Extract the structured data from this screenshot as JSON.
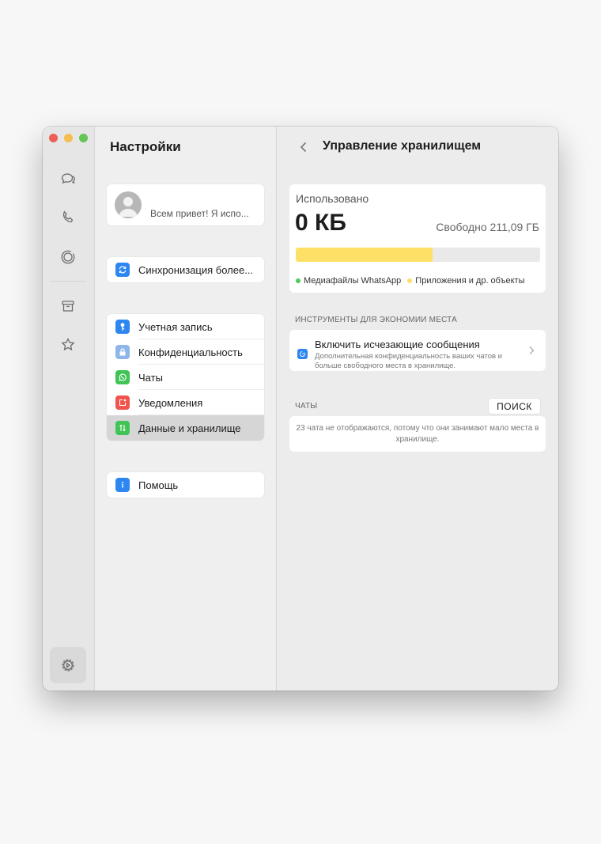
{
  "window": {
    "traffic_lights": {
      "close": "#ec5f57",
      "minimize": "#f4bf4f",
      "zoom": "#62c554"
    }
  },
  "rail": {
    "items": [
      {
        "name": "chats",
        "icon": "chat-bubbles-icon"
      },
      {
        "name": "calls",
        "icon": "phone-icon"
      },
      {
        "name": "status",
        "icon": "status-ring-icon"
      },
      {
        "name": "archive",
        "icon": "archive-box-icon"
      },
      {
        "name": "starred",
        "icon": "star-icon"
      }
    ],
    "bottom": {
      "name": "settings",
      "icon": "gear-icon",
      "active": true
    }
  },
  "settings": {
    "title": "Настройки",
    "profile": {
      "status": "Всем привет! Я испо..."
    },
    "sync": {
      "label": "Синхронизация более...",
      "icon": "sync-icon",
      "color": "#2e86f0"
    },
    "menu": [
      {
        "label": "Учетная запись",
        "icon": "key-icon",
        "color": "#2e86f0"
      },
      {
        "label": "Конфиденциальность",
        "icon": "lock-icon",
        "color": "#8fb6ea"
      },
      {
        "label": "Чаты",
        "icon": "whatsapp-icon",
        "color": "#3fc455"
      },
      {
        "label": "Уведомления",
        "icon": "notification-icon",
        "color": "#f0544c"
      },
      {
        "label": "Данные и хранилище",
        "icon": "data-arrows-icon",
        "color": "#3fc455",
        "selected": true
      }
    ],
    "help": {
      "label": "Помощь",
      "icon": "info-icon",
      "color": "#2e86f0"
    }
  },
  "detail": {
    "title": "Управление хранилищем",
    "usage": {
      "used_label": "Использовано",
      "used_value": "0 КБ",
      "free_label": "Свободно 211,09 ГБ",
      "bar_fill_fraction": 0.56,
      "bar_color": "#ffe066",
      "legend": [
        {
          "label": "Медиафайлы WhatsApp",
          "color": "#4cc95a"
        },
        {
          "label": "Приложения и др. объекты",
          "color": "#ffe066"
        }
      ]
    },
    "tools": {
      "header": "ИНСТРУМЕНТЫ ДЛЯ ЭКОНОМИИ МЕСТА",
      "item": {
        "title": "Включить исчезающие сообщения",
        "description": "Дополнительная конфиденциальность ваших чатов и больше свободного места в хранилище."
      }
    },
    "chats": {
      "header": "ЧАТЫ",
      "search_label": "ПОИСК",
      "info": "23 чата не отображаются, потому что они занимают мало места в хранилище."
    }
  }
}
